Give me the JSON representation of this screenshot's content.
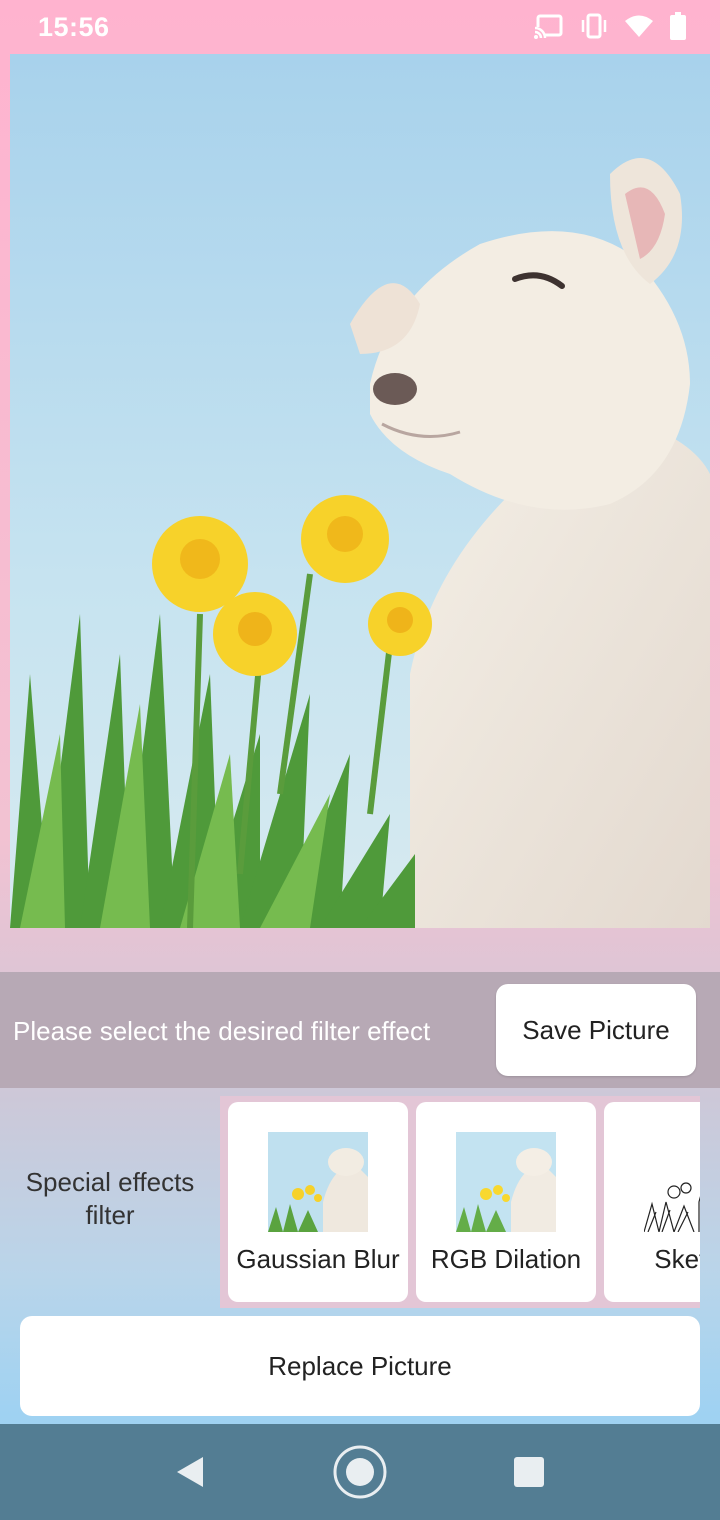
{
  "status_bar": {
    "time": "15:56",
    "icons": [
      "cast-icon",
      "vibrate-icon",
      "wifi-icon",
      "battery-icon"
    ]
  },
  "photo": {
    "description_icon": "lamb-photo"
  },
  "filter_prompt": {
    "text": "Please select the desired filter effect",
    "save_label": "Save Picture"
  },
  "effects": {
    "section_label_line1": "Special effects",
    "section_label_line2": "filter",
    "items": [
      {
        "label": "Gaussian Blur"
      },
      {
        "label": "RGB Dilation"
      },
      {
        "label": "Sketch"
      }
    ]
  },
  "replace_label": "Replace Picture",
  "nav": {
    "buttons": [
      "back-icon",
      "home-icon",
      "recents-icon"
    ]
  },
  "colors": {
    "nav_bg": "#537d93",
    "prompt_bg": "#b7a9b5",
    "strip_bg": "#e3c6d6"
  }
}
